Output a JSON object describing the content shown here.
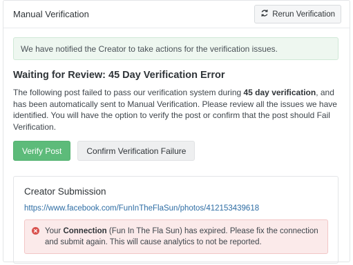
{
  "header": {
    "title": "Manual Verification",
    "rerun_label": "Rerun Verification"
  },
  "notice": "We have notified the Creator to take actions for the verification issues.",
  "review": {
    "title": "Waiting for Review: 45 Day Verification Error",
    "desc_pre": "The following post failed to pass our verification system during ",
    "desc_bold": "45 day verification",
    "desc_post": ", and has been automatically sent to Manual Verification. Please review all the issues we have identified. You will have the option to verify the post or confirm that the post should Fail Verification."
  },
  "actions": {
    "verify_label": "Verify Post",
    "fail_label": "Confirm Verification Failure"
  },
  "submission": {
    "title": "Creator Submission",
    "link": "https://www.facebook.com/FunInTheFlaSun/photos/412153439618",
    "error_pre": "Your ",
    "error_bold": "Connection",
    "error_post": " (Fun In The Fla Sun) has expired. Please fix the connection and submit again. This will cause analytics to not be reported."
  },
  "colors": {
    "primary": "#5dbb7a",
    "success_bg": "#eef7f0",
    "error_bg": "#fbeaea",
    "error_icon": "#d9534f",
    "link": "#2e6da4"
  },
  "icons": {
    "rerun": "refresh-icon",
    "error": "error-circle-icon"
  }
}
